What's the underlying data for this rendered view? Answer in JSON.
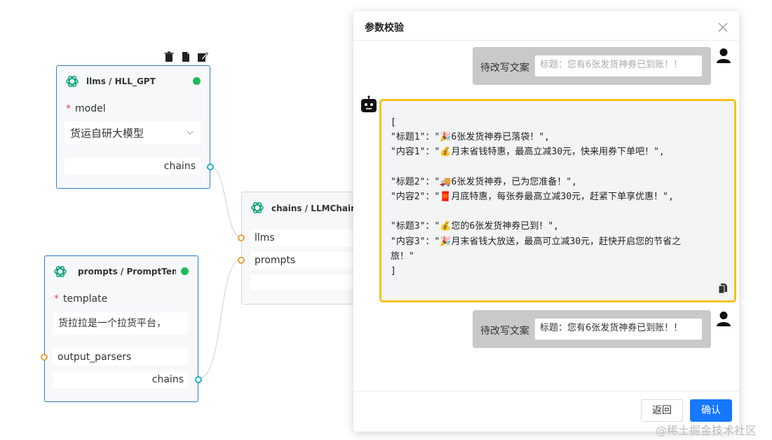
{
  "canvas": {
    "node_llms": {
      "title": "llms / HLL_GPT",
      "model_label": "model",
      "model_value": "货运自研大模型",
      "output_label": "chains"
    },
    "node_chain": {
      "title": "chains / LLMChain",
      "input_llms": "llms",
      "input_prompts": "prompts"
    },
    "node_prompts": {
      "title": "prompts / PromptTem...",
      "template_label": "template",
      "template_value": "货拉拉是一个拉货平台，",
      "output_parsers_label": "output_parsers",
      "output_label": "chains"
    },
    "toolbar": {
      "delete_icon": "trash-icon",
      "copy_icon": "copy-icon",
      "edit_icon": "edit-icon"
    }
  },
  "dialog": {
    "title": "参数校验",
    "user_message_1": {
      "label": "待改写文案",
      "value": "标题：您有6张发货神券已到账！！",
      "placeholder": "标题：您有6张发货神券已到账！！"
    },
    "bot_reply_lines": [
      "[",
      "\"标题1\"：\"🎉6张发货神券已落袋！\",",
      "\"内容1\"：\"💰月末省钱特惠，最高立减30元，快来用券下单吧！\",",
      "",
      "\"标题2\"：\"🚚6张发货神券，已为您准备！\",",
      "\"内容2\"：\"🧧月底特惠，每张券最高立减30元，赶紧下单享优惠！\",",
      "",
      "\"标题3\"：\"💰您的6张发货神券已到！\",",
      "\"内容3\"：\"🎉月末省钱大放送，最高可立减30元，赶快开启您的节省之",
      "旅！\"",
      "]"
    ],
    "user_message_2": {
      "label": "待改写文案",
      "value": "标题：您有6张发货神券已到账！！"
    },
    "buttons": {
      "back": "返回",
      "confirm": "确认"
    }
  },
  "watermark": "@稀土掘金技术社区",
  "colors": {
    "accent": "#1677ff",
    "node_border": "#2b7fd1",
    "highlight_border": "#f2c21a",
    "status_green": "#20b95c",
    "port_output": "#19b3c6",
    "port_input": "#e7a23a"
  }
}
